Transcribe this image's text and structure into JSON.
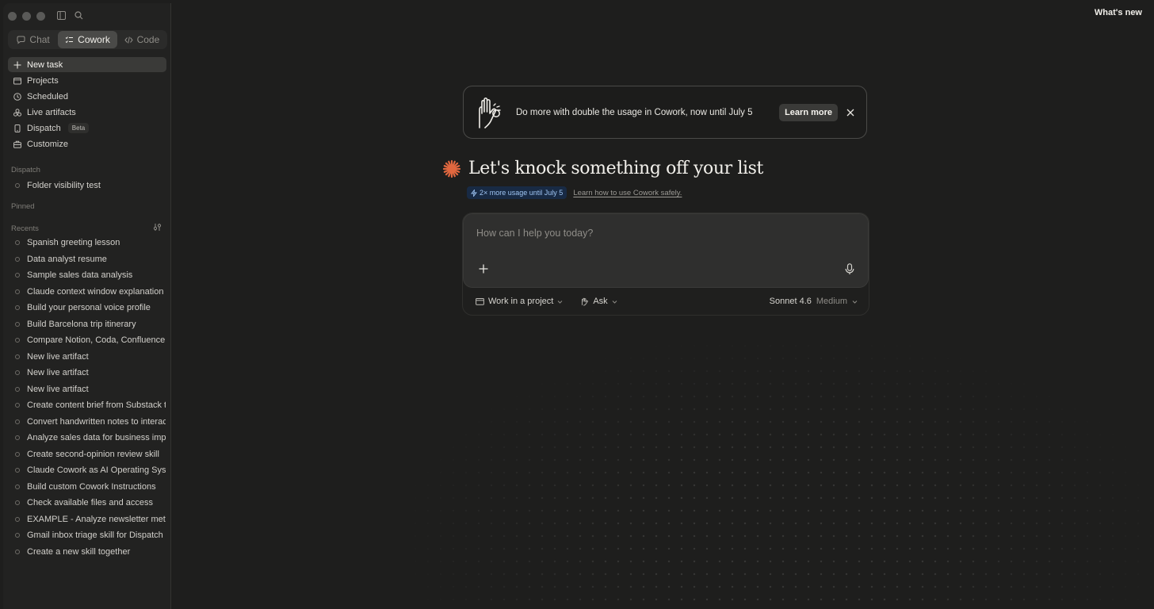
{
  "window": {
    "whats_new": "What's new"
  },
  "sidebar": {
    "mode_tabs": [
      {
        "label": "Chat",
        "icon": "chat-bubble-icon"
      },
      {
        "label": "Cowork",
        "icon": "checklist-icon",
        "active": true
      },
      {
        "label": "Code",
        "icon": "code-brackets-icon"
      }
    ],
    "nav": [
      {
        "label": "New task",
        "icon": "plus-icon",
        "active": true
      },
      {
        "label": "Projects",
        "icon": "folder-icon"
      },
      {
        "label": "Scheduled",
        "icon": "clock-icon"
      },
      {
        "label": "Live artifacts",
        "icon": "shapes-icon"
      },
      {
        "label": "Dispatch",
        "icon": "phone-icon",
        "badge": "Beta"
      },
      {
        "label": "Customize",
        "icon": "briefcase-icon"
      }
    ],
    "dispatch_label": "Dispatch",
    "dispatch_items": [
      "Folder visibility test"
    ],
    "pinned_label": "Pinned",
    "recents_label": "Recents",
    "recents": [
      "Spanish greeting lesson",
      "Data analyst resume",
      "Sample sales data analysis",
      "Claude context window explanation",
      "Build your personal voice profile",
      "Build Barcelona trip itinerary",
      "Compare Notion, Coda, Confluence p",
      "New live artifact",
      "New live artifact",
      "New live artifact",
      "Create content brief from Substack tr",
      "Convert handwritten notes to interac",
      "Analyze sales data for business impro",
      "Create second-opinion review skill",
      "Claude Cowork as AI Operating Syste",
      "Build custom Cowork Instructions",
      "Check available files and access",
      "EXAMPLE - Analyze newsletter metri",
      "Gmail inbox triage skill for Dispatch",
      "Create a new skill together"
    ]
  },
  "banner": {
    "text": "Do more with double the usage in Cowork, now until July 5",
    "button": "Learn more"
  },
  "main": {
    "headline": "Let's knock something off your list",
    "usage_pill": "2× more usage until July 5",
    "safety_link": "Learn how to use Cowork safely."
  },
  "composer": {
    "placeholder": "How can I help you today?",
    "project_label": "Work in a project",
    "mode_label": "Ask",
    "model": "Sonnet 4.6",
    "effort": "Medium"
  },
  "colors": {
    "accent_orange": "#e0673f",
    "pill_blue": "#9ec4f2",
    "background": "#1e1e1d"
  }
}
